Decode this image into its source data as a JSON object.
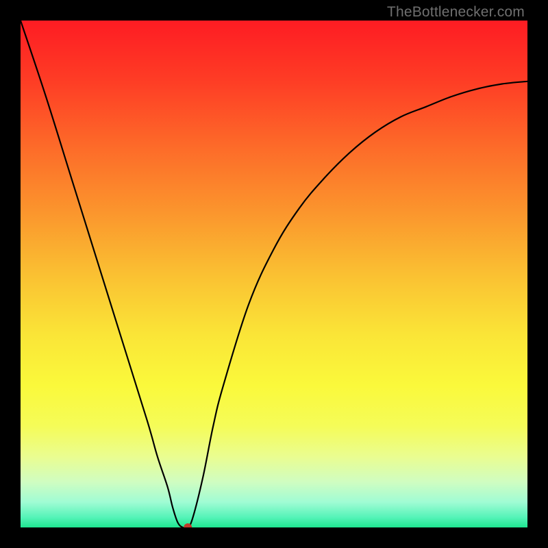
{
  "watermark": "TheBottlenecker.com",
  "chart_data": {
    "type": "line",
    "title": "",
    "xlabel": "",
    "ylabel": "",
    "xlim": [
      0,
      100
    ],
    "ylim": [
      0,
      100
    ],
    "x": [
      0,
      5,
      10,
      15,
      20,
      25,
      27,
      29,
      30,
      31,
      32,
      33,
      34,
      36,
      38,
      40,
      45,
      50,
      55,
      60,
      65,
      70,
      75,
      80,
      85,
      90,
      95,
      100
    ],
    "values": [
      100,
      85,
      69,
      53,
      37,
      21,
      14,
      8,
      4,
      1,
      0,
      0,
      2,
      10,
      20,
      28,
      44,
      55,
      63,
      69,
      74,
      78,
      81,
      83,
      85,
      86.5,
      87.5,
      88
    ],
    "marker": {
      "x": 33,
      "y": 0,
      "color": "#c0392b"
    },
    "gradient_stops": [
      {
        "pos": 0.0,
        "color": "#fe1c23"
      },
      {
        "pos": 0.12,
        "color": "#fe3d25"
      },
      {
        "pos": 0.25,
        "color": "#fd6b29"
      },
      {
        "pos": 0.38,
        "color": "#fb962d"
      },
      {
        "pos": 0.5,
        "color": "#fac032"
      },
      {
        "pos": 0.62,
        "color": "#fae537"
      },
      {
        "pos": 0.72,
        "color": "#faf93b"
      },
      {
        "pos": 0.8,
        "color": "#f5fc58"
      },
      {
        "pos": 0.86,
        "color": "#eafd90"
      },
      {
        "pos": 0.91,
        "color": "#d0fdc1"
      },
      {
        "pos": 0.95,
        "color": "#a0fcd4"
      },
      {
        "pos": 0.98,
        "color": "#55f3b8"
      },
      {
        "pos": 1.0,
        "color": "#1ee690"
      }
    ]
  }
}
